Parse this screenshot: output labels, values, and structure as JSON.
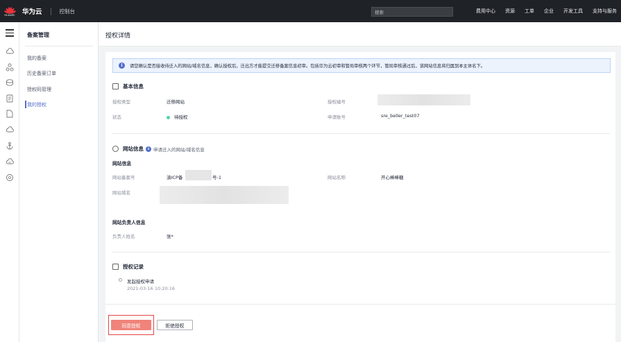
{
  "topbar": {
    "logo_text": "HUAWEI",
    "brand": "华为云",
    "console": "控制台",
    "search_placeholder": "搜索",
    "nav": [
      "费用中心",
      "资源",
      "工单",
      "企业",
      "开发工具",
      "支持与服务"
    ]
  },
  "sidebar": {
    "title": "备案管理",
    "items": [
      {
        "label": "我的备案",
        "active": false
      },
      {
        "label": "历史备案订单",
        "active": false
      },
      {
        "label": "授权码管理",
        "active": false
      },
      {
        "label": "我的授权",
        "active": true
      }
    ]
  },
  "page": {
    "title": "授权详情",
    "notice": "请您确认是否接收待迁入的网站/域名信息，确认授权后，迁出方才能提交迁移备案信息初审。包括华为云初审和管局审核两个环节，管局审核通过后，该网站信息将归属到本主体名下。"
  },
  "basic_info": {
    "title": "基本信息",
    "auth_type_label": "授权类型",
    "auth_type_value": "迁移网站",
    "auth_no_label": "授权编号",
    "status_label": "状态",
    "status_value": "待授权",
    "applicant_label": "申请账号",
    "applicant_value": "sre_beller_test07"
  },
  "site_info": {
    "title": "网站信息",
    "subtitle": "申请迁入的网站/域名信息",
    "sub_heading": "网站信息",
    "record_no_label": "网站备案号",
    "record_no_prefix": "滇ICP备",
    "record_no_suffix": "号-1",
    "site_name_label": "网站名称",
    "site_name_value": "开心棒棒糖",
    "domain_label": "网站域名",
    "owner_heading": "网站负责人信息",
    "owner_name_label": "负责人姓名",
    "owner_name_value": "张*"
  },
  "records": {
    "title": "授权记录",
    "event": "发起授权申请",
    "time": "2021-03-16 10:20:16"
  },
  "actions": {
    "approve": "同意授权",
    "reject": "拒绝授权"
  },
  "colors": {
    "topbar": "#1f2227",
    "accent": "#526ecc",
    "primary_btn": "#f0837a",
    "status_dot": "#50d4ab",
    "highlight_box": "#e54545"
  }
}
